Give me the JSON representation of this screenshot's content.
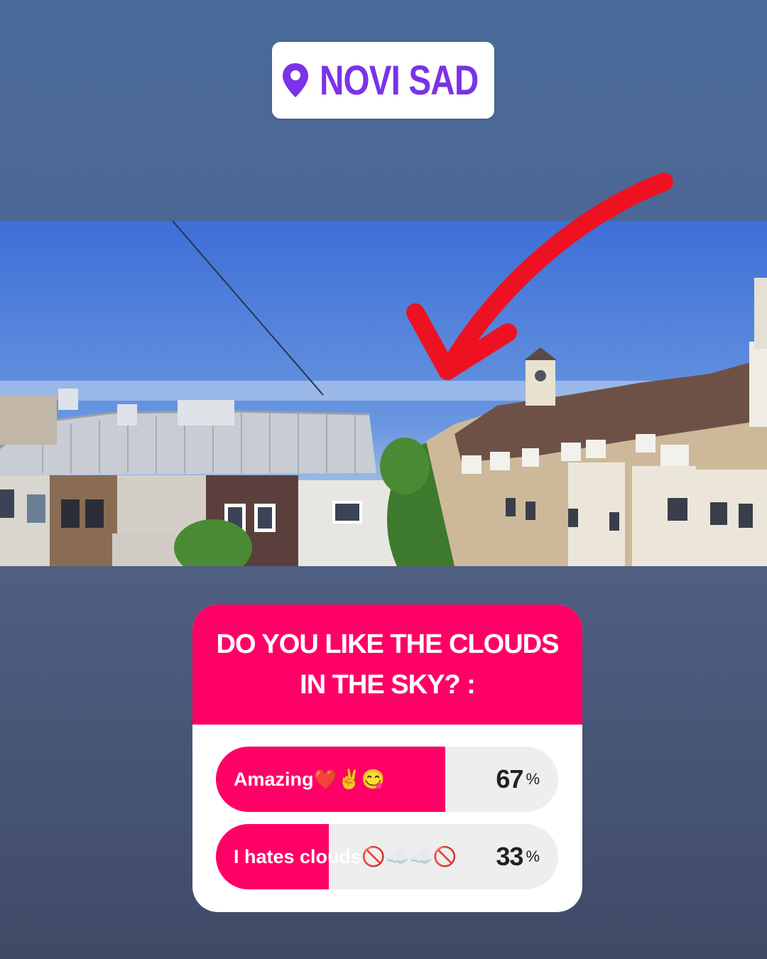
{
  "location_sticker": {
    "icon": "location-pin-icon",
    "text": "NOVI SAD",
    "color": "#7a33e6"
  },
  "photo": {
    "overlay_icon": "red-arrow-icon",
    "arrow_color": "#ee1122"
  },
  "poll": {
    "question": "DO YOU LIKE THE CLOUDS IN THE SKY? :",
    "accent_color": "#ff0066",
    "options": [
      {
        "label": "Amazing❤️✌️😋",
        "percent": "67",
        "percent_sign": "%",
        "fraction": 0.67
      },
      {
        "label": "I hates clouds🚫☁️☁️🚫",
        "percent": "33",
        "percent_sign": "%",
        "fraction": 0.33
      }
    ]
  }
}
